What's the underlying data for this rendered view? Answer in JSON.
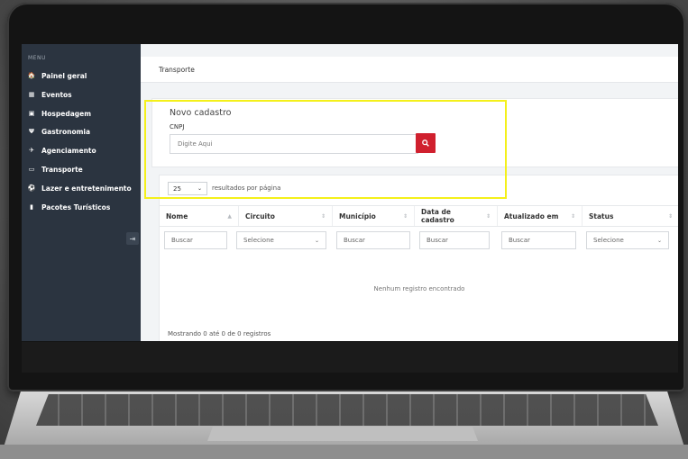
{
  "sidebar": {
    "menu_label": "MENU",
    "items": [
      {
        "label": "Painel geral",
        "icon": "home-icon",
        "glyph": "🏠"
      },
      {
        "label": "Eventos",
        "icon": "calendar-icon",
        "glyph": "▦"
      },
      {
        "label": "Hospedagem",
        "icon": "bed-icon",
        "glyph": "▣"
      },
      {
        "label": "Gastronomia",
        "icon": "fork-knife-icon",
        "glyph": "Ψ"
      },
      {
        "label": "Agenciamento",
        "icon": "plane-icon",
        "glyph": "✈"
      },
      {
        "label": "Transporte",
        "icon": "bus-icon",
        "glyph": "▭"
      },
      {
        "label": "Lazer e entretenimento",
        "icon": "soccer-ball-icon",
        "glyph": "⚽"
      },
      {
        "label": "Pacotes Turísticos",
        "icon": "suitcase-icon",
        "glyph": "▮"
      }
    ],
    "collapse_glyph": "⇥"
  },
  "breadcrumb": "Transporte",
  "form": {
    "title": "Novo cadastro",
    "cnpj_label": "CNPJ",
    "cnpj_placeholder": "Digite Aqui",
    "search_glyph": "⚲"
  },
  "table": {
    "page_size": "25",
    "page_size_suffix": "resultados por página",
    "columns": [
      {
        "label": "Nome",
        "sort": "▲"
      },
      {
        "label": "Circuito",
        "sort": "⇕"
      },
      {
        "label": "Município",
        "sort": "⇕"
      },
      {
        "label": "Data de cadastro",
        "sort": "⇕"
      },
      {
        "label": "Atualizado em",
        "sort": "⇕"
      },
      {
        "label": "Status",
        "sort": "⇕"
      }
    ],
    "filters": [
      "Buscar",
      "Selecione",
      "Buscar",
      "Buscar",
      "Buscar",
      "Selecione"
    ],
    "empty_message": "Nenhum registro encontrado",
    "footer": "Mostrando 0 até 0 de 0 registros"
  },
  "colors": {
    "sidebar": "#2b3440",
    "accent_red": "#d0202e",
    "highlight": "#f4f01a"
  }
}
